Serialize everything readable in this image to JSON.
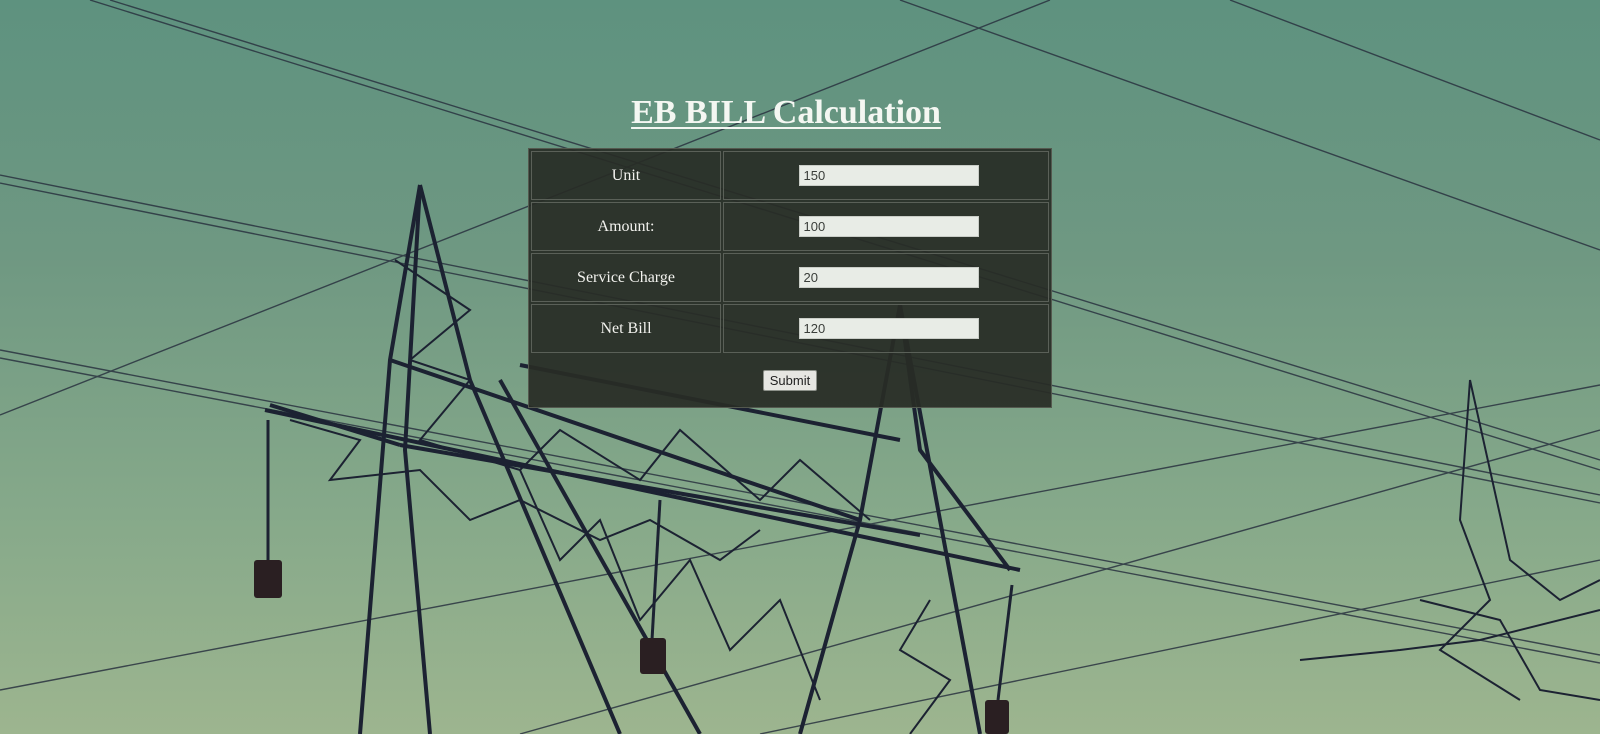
{
  "page": {
    "title": "EB BILL Calculation"
  },
  "form": {
    "rows": [
      {
        "label": "Unit",
        "value": "150"
      },
      {
        "label": "Amount:",
        "value": "100"
      },
      {
        "label": "Service Charge",
        "value": "20"
      },
      {
        "label": "Net Bill",
        "value": "120"
      }
    ],
    "submit_label": "Submit"
  },
  "background": {
    "subject": "electricity-transmission-tower-photo",
    "sky_color_top": "#5e927f",
    "sky_color_bottom": "#9db58f",
    "structure_color": "#1c2232"
  }
}
